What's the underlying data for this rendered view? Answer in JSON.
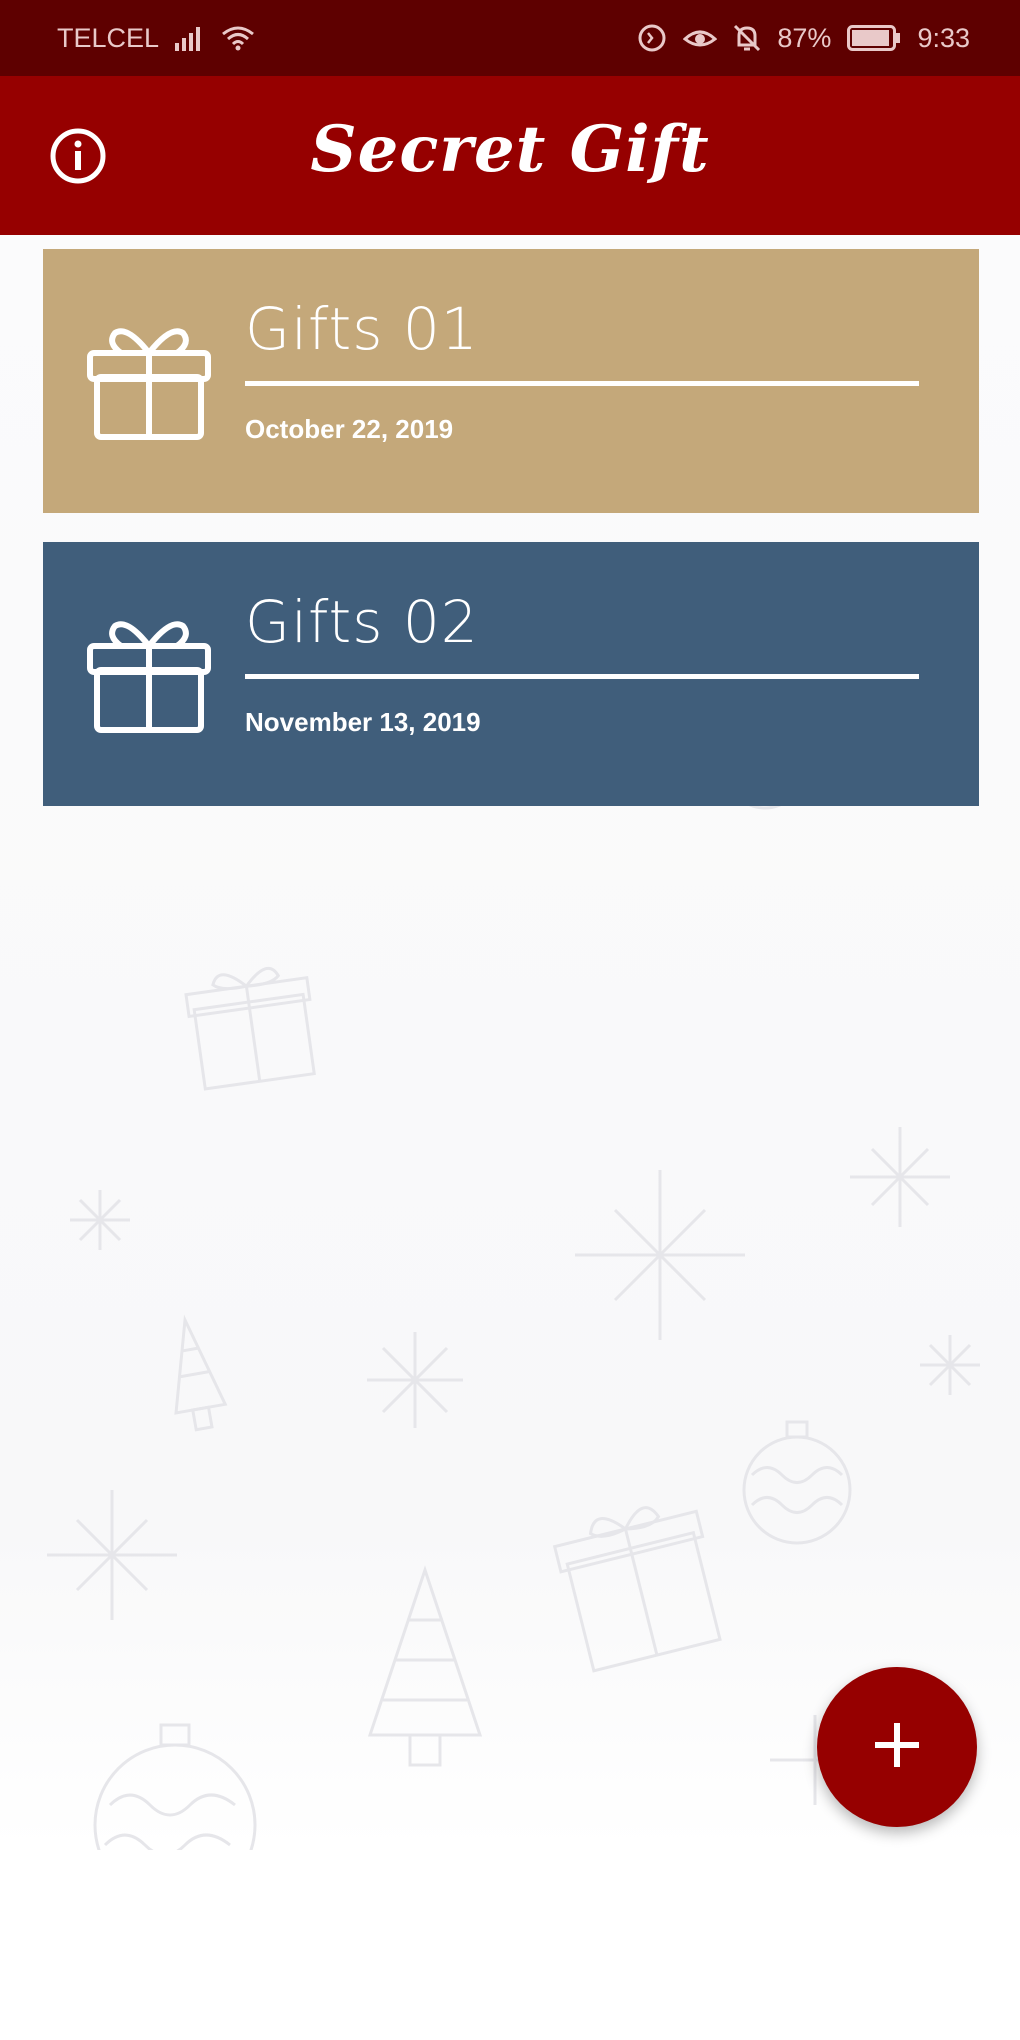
{
  "status_bar": {
    "carrier": "TELCEL",
    "battery": "87%",
    "time": "9:33",
    "icons": [
      "signal-icon",
      "wifi-icon",
      "data-saver-icon",
      "eye-comfort-icon",
      "notifications-off-icon",
      "battery-icon"
    ]
  },
  "app_bar": {
    "title": "Secret Gift",
    "info_icon": "info-icon",
    "background": "#960000"
  },
  "gift_lists": [
    {
      "title": "Gifts 01",
      "date": "October 22, 2019",
      "color": "#c4a87a",
      "icon": "gift-icon"
    },
    {
      "title": "Gifts 02",
      "date": "November 13, 2019",
      "color": "#405e7b",
      "icon": "gift-icon"
    }
  ],
  "fab": {
    "icon": "plus-icon",
    "color": "#960000"
  }
}
